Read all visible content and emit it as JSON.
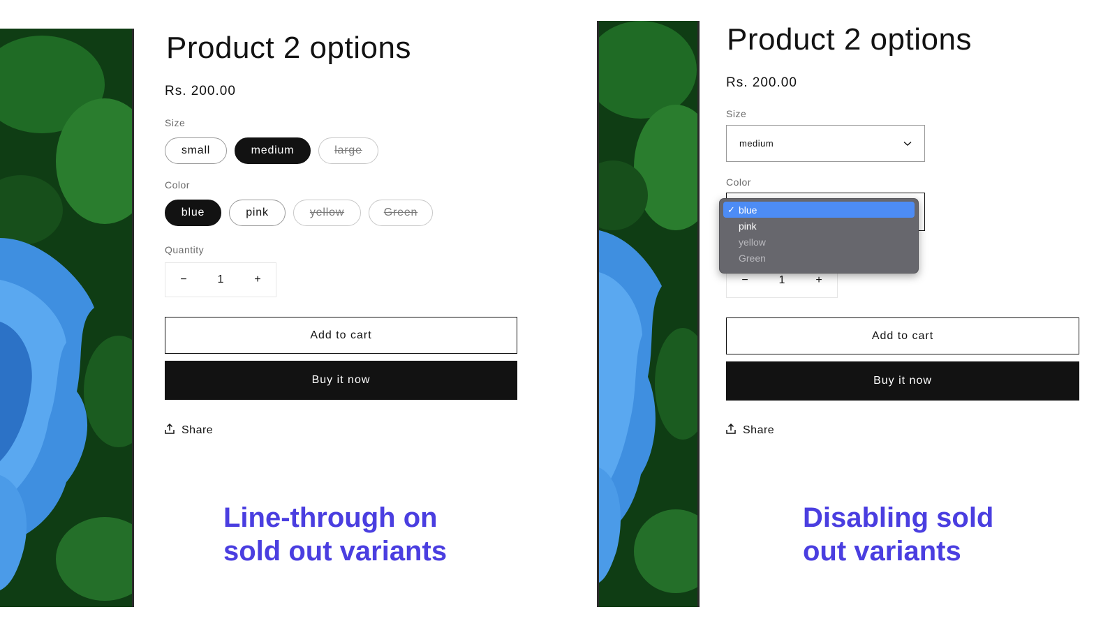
{
  "left": {
    "title": "Product 2 options",
    "price": "Rs. 200.00",
    "size_label": "Size",
    "sizes": [
      {
        "label": "small",
        "state": "available"
      },
      {
        "label": "medium",
        "state": "selected"
      },
      {
        "label": "large",
        "state": "sold-out"
      }
    ],
    "color_label": "Color",
    "colors": [
      {
        "label": "blue",
        "state": "selected"
      },
      {
        "label": "pink",
        "state": "available"
      },
      {
        "label": "yellow",
        "state": "sold-out"
      },
      {
        "label": "Green",
        "state": "sold-out"
      }
    ],
    "quantity_label": "Quantity",
    "quantity": {
      "minus": "−",
      "value": "1",
      "plus": "+"
    },
    "add_to_cart": "Add to cart",
    "buy_now": "Buy it now",
    "share": "Share",
    "caption_line1": "Line-through on",
    "caption_line2": "sold out variants"
  },
  "right": {
    "title": "Product 2 options",
    "price": "Rs. 200.00",
    "size_label": "Size",
    "size_select_value": "medium",
    "color_label": "Color",
    "color_options": [
      {
        "label": "blue",
        "checked": true,
        "disabled": false
      },
      {
        "label": "pink",
        "checked": false,
        "disabled": false
      },
      {
        "label": "yellow",
        "checked": false,
        "disabled": true
      },
      {
        "label": "Green",
        "checked": false,
        "disabled": true
      }
    ],
    "check_mark": "✓",
    "quantity": {
      "minus": "−",
      "value": "1",
      "plus": "+"
    },
    "add_to_cart": "Add to cart",
    "buy_now": "Buy it now",
    "share": "Share",
    "caption_line1": "Disabling sold",
    "caption_line2": "out variants"
  },
  "colors": {
    "caption": "#4a3ee0",
    "selected": "#121212",
    "dropdown_bg": "#67676d",
    "dropdown_highlight": "#4d8cf5"
  },
  "icons": {
    "share": "share-icon",
    "chevron": "chevron-down-icon",
    "check": "check-icon"
  }
}
